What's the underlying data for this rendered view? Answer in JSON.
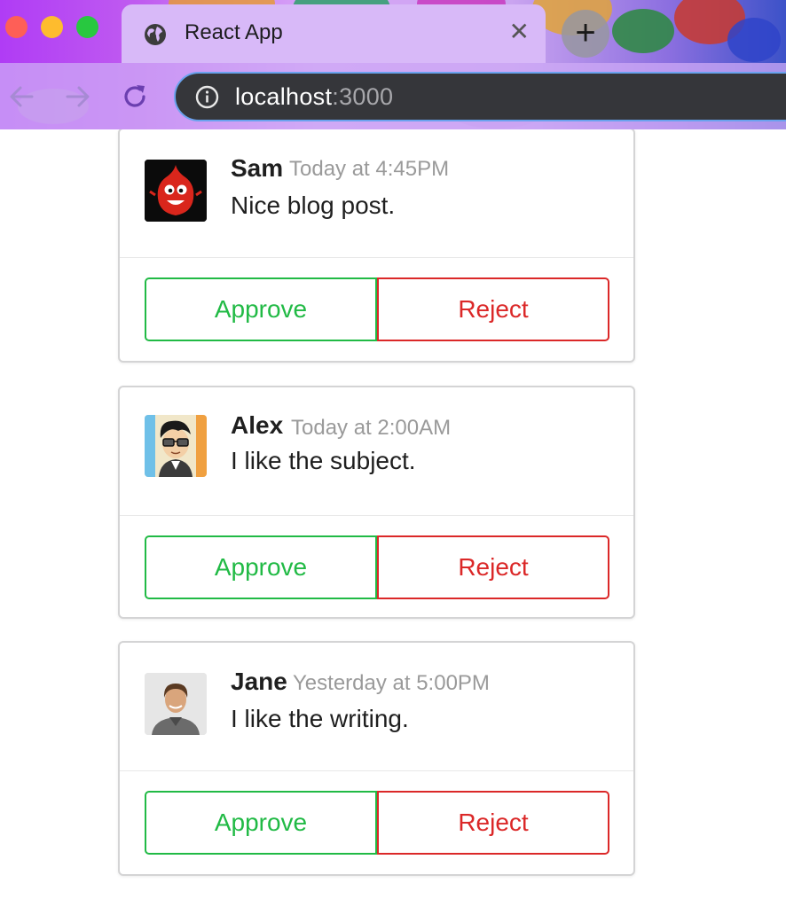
{
  "browser": {
    "tab_title": "React App",
    "tab_close": "✕",
    "new_tab": "+",
    "url_host": "localhost",
    "url_port": ":3000"
  },
  "colors": {
    "approve": "#21ba45",
    "reject": "#db2828",
    "meta_text": "#9a9a9a",
    "omnibox_bg": "#35363a"
  },
  "comments": [
    {
      "author": "Sam",
      "metadata": "Today at 4:45PM",
      "text": "Nice blog post.",
      "avatar": "red-monster-avatar",
      "approve_label": "Approve",
      "reject_label": "Reject"
    },
    {
      "author": "Alex",
      "metadata": "Today at 2:00AM",
      "text": "I like the subject.",
      "avatar": "cartoon-glasses-avatar",
      "approve_label": "Approve",
      "reject_label": "Reject"
    },
    {
      "author": "Jane",
      "metadata": "Yesterday at 5:00PM",
      "text": "I like the writing.",
      "avatar": "photo-avatar",
      "approve_label": "Approve",
      "reject_label": "Reject"
    }
  ]
}
